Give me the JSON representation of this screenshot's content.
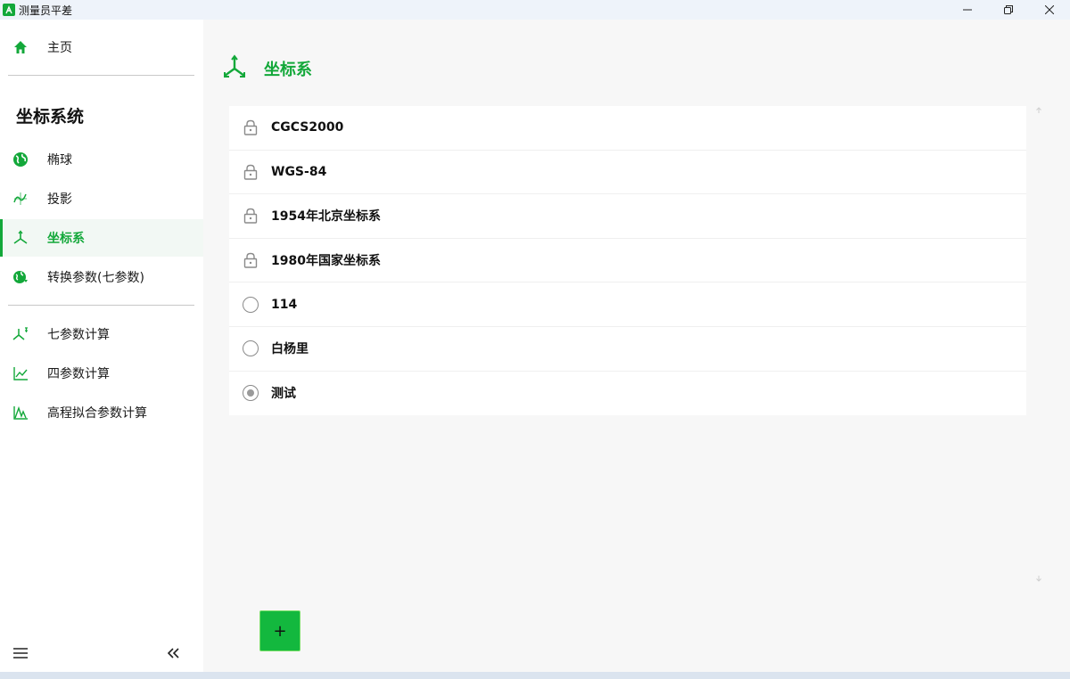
{
  "window": {
    "title": "测量员平差",
    "controls": {
      "minimize": "—",
      "restore": "❐",
      "close": "✕"
    }
  },
  "sidebar": {
    "home_label": "主页",
    "section_title": "坐标系统",
    "items": [
      {
        "label": "椭球",
        "icon": "globe-icon"
      },
      {
        "label": "投影",
        "icon": "projection-icon"
      },
      {
        "label": "坐标系",
        "icon": "axis-icon",
        "active": true
      },
      {
        "label": "转换参数(七参数)",
        "icon": "globe-arrows-icon"
      }
    ],
    "tools": [
      {
        "label": "七参数计算",
        "icon": "seven-param-icon"
      },
      {
        "label": "四参数计算",
        "icon": "chart-line-icon"
      },
      {
        "label": "高程拟合参数计算",
        "icon": "elevation-icon"
      }
    ]
  },
  "main": {
    "title": "坐标系",
    "coordinate_systems": [
      {
        "name": "CGCS2000",
        "state": "locked"
      },
      {
        "name": "WGS-84",
        "state": "locked"
      },
      {
        "name": "1954年北京坐标系",
        "state": "locked"
      },
      {
        "name": "1980年国家坐标系",
        "state": "locked"
      },
      {
        "name": "114",
        "state": "radio"
      },
      {
        "name": "白杨里",
        "state": "radio"
      },
      {
        "name": "测试",
        "state": "radio-checked"
      }
    ],
    "add_button": "+"
  },
  "colors": {
    "accent": "#13a83a",
    "background": "#f7f7f7",
    "card": "#ffffff"
  }
}
